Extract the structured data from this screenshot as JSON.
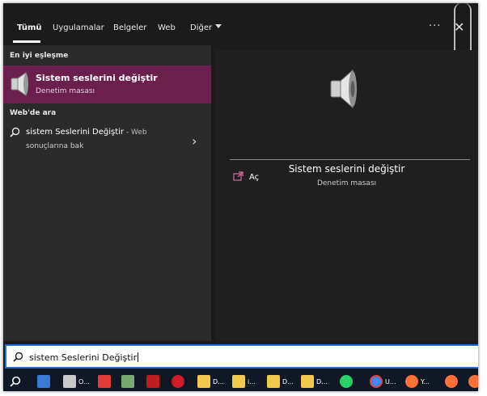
{
  "tabs": [
    {
      "label": "Tümü",
      "active": true
    },
    {
      "label": "Uygulamalar"
    },
    {
      "label": "Belgeler"
    },
    {
      "label": "Web"
    },
    {
      "label": "Diğer"
    }
  ],
  "header": {
    "more_label": "···",
    "close_label": "✕"
  },
  "sections": {
    "best_match": "En iyi eşleşme",
    "web_search": "Web'de ara"
  },
  "best_match": {
    "title": "Sistem seslerini değiştir",
    "subtitle": "Denetim masası"
  },
  "web_result": {
    "query": "sistem Seslerini Değiştir",
    "suffix": " - Web",
    "line2": "sonuçlarına bak"
  },
  "detail": {
    "title": "Sistem seslerini değiştir",
    "subtitle": "Denetim masası",
    "action_open": "Aç"
  },
  "search": {
    "value": "sistem Seslerini Değiştir"
  },
  "taskbar": [
    {
      "icon": "search-icon",
      "label": ""
    },
    {
      "icon": "laptop-icon",
      "label": ""
    },
    {
      "icon": "explorer-icon",
      "label": "O..."
    },
    {
      "icon": "anydesk-icon",
      "label": ""
    },
    {
      "icon": "network-icon",
      "label": ""
    },
    {
      "icon": "filezilla-icon",
      "label": ""
    },
    {
      "icon": "opera-icon",
      "label": ""
    },
    {
      "icon": "folder-icon",
      "label": "D..."
    },
    {
      "icon": "folder-icon",
      "label": "i..."
    },
    {
      "icon": "folder-icon",
      "label": "D..."
    },
    {
      "icon": "folder-icon",
      "label": "D..."
    },
    {
      "icon": "whatsapp-icon",
      "label": ""
    },
    {
      "icon": "chrome-icon",
      "label": "U..."
    },
    {
      "icon": "firefox-icon",
      "label": "Y..."
    },
    {
      "icon": "firefox-icon",
      "label": ""
    },
    {
      "icon": "firefox-icon",
      "label": ""
    }
  ],
  "colors": {
    "accent": "#6b1f4c",
    "search_border": "#1e72c8",
    "taskbar": "#101826"
  }
}
